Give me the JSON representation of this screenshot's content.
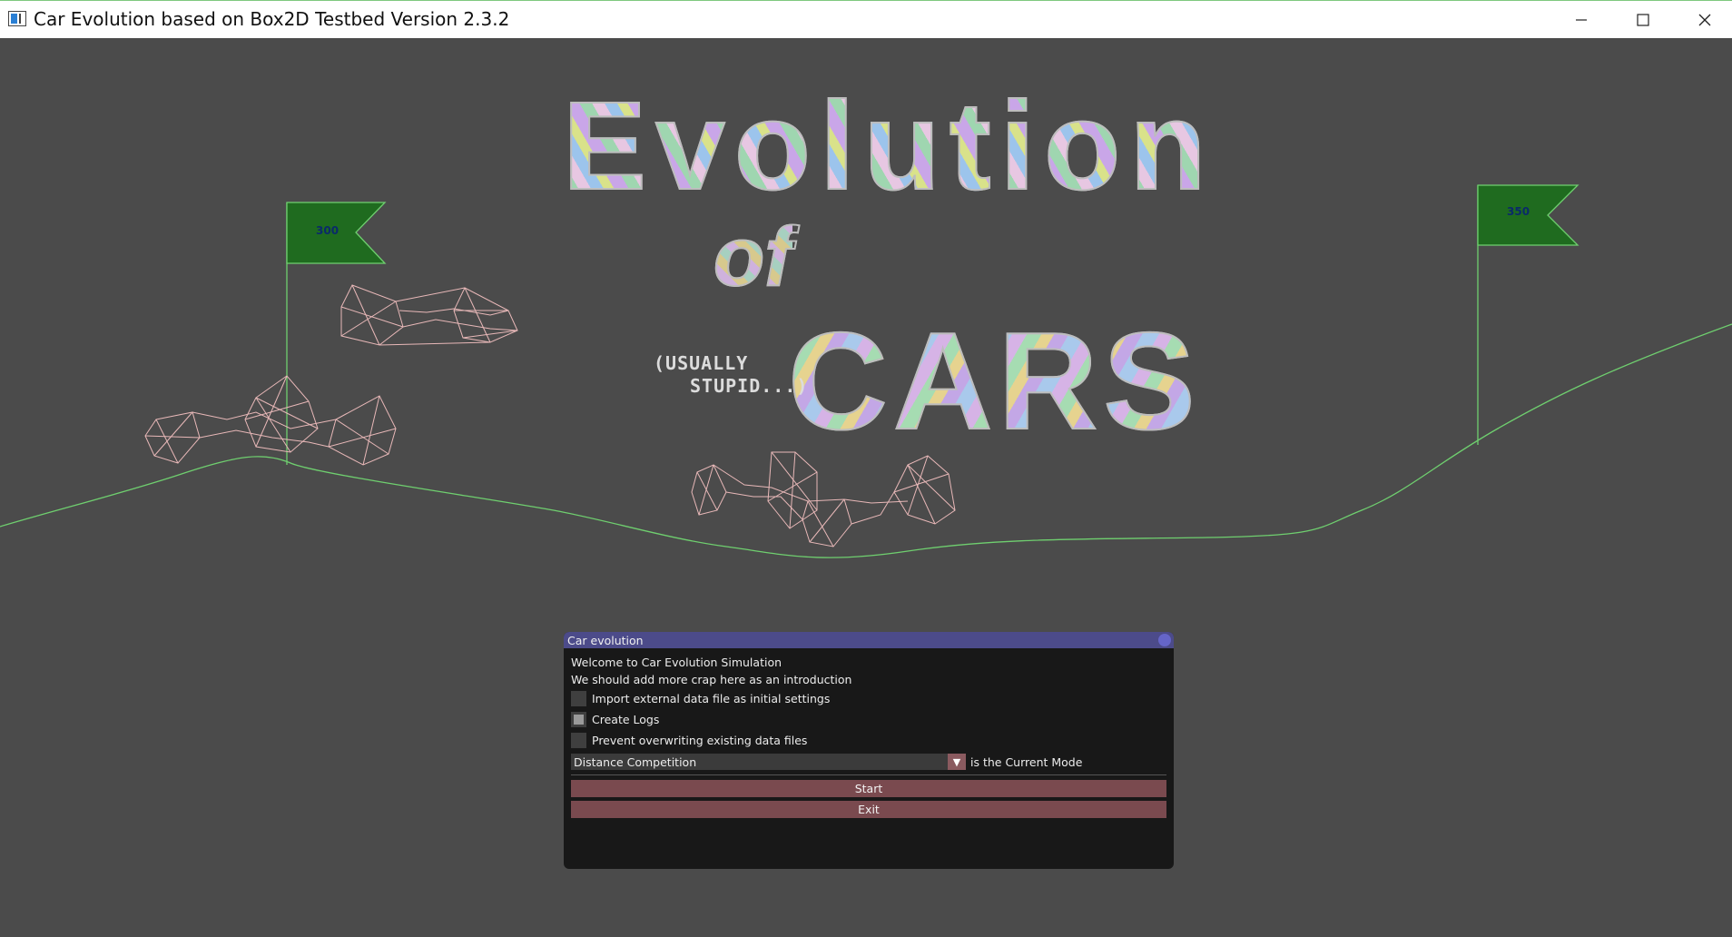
{
  "window": {
    "title": "Car Evolution based on Box2D Testbed Version 2.3.2",
    "controls": [
      "minimize-icon",
      "maximize-icon",
      "close-icon"
    ]
  },
  "scene": {
    "flags": [
      {
        "label": "300"
      },
      {
        "label": "350"
      }
    ],
    "logo": {
      "line1": "Evolution",
      "line2": "of",
      "line3": "CARS",
      "aside_line1": "(USUALLY",
      "aside_line2": "STUPID...)"
    },
    "colors": {
      "background": "#4b4b4b",
      "ground": "#6fcf6f",
      "flag_fill": "#1f6b1f",
      "car_wireframe": "#e8b8b8"
    }
  },
  "panel": {
    "title": "Car evolution",
    "welcome": "Welcome to Car Evolution Simulation",
    "intro": "We should add more crap here as an introduction",
    "options": [
      {
        "label": "Import external data file as initial settings",
        "checked": false
      },
      {
        "label": "Create Logs",
        "checked": true
      },
      {
        "label": "Prevent overwriting existing data files",
        "checked": false
      }
    ],
    "mode": {
      "selected": "Distance Competition",
      "suffix": "is the Current Mode"
    },
    "buttons": {
      "start": "Start",
      "exit": "Exit"
    },
    "colors": {
      "header": "#4c4b8a",
      "button": "#7a4a4f",
      "body": "#181818"
    }
  }
}
